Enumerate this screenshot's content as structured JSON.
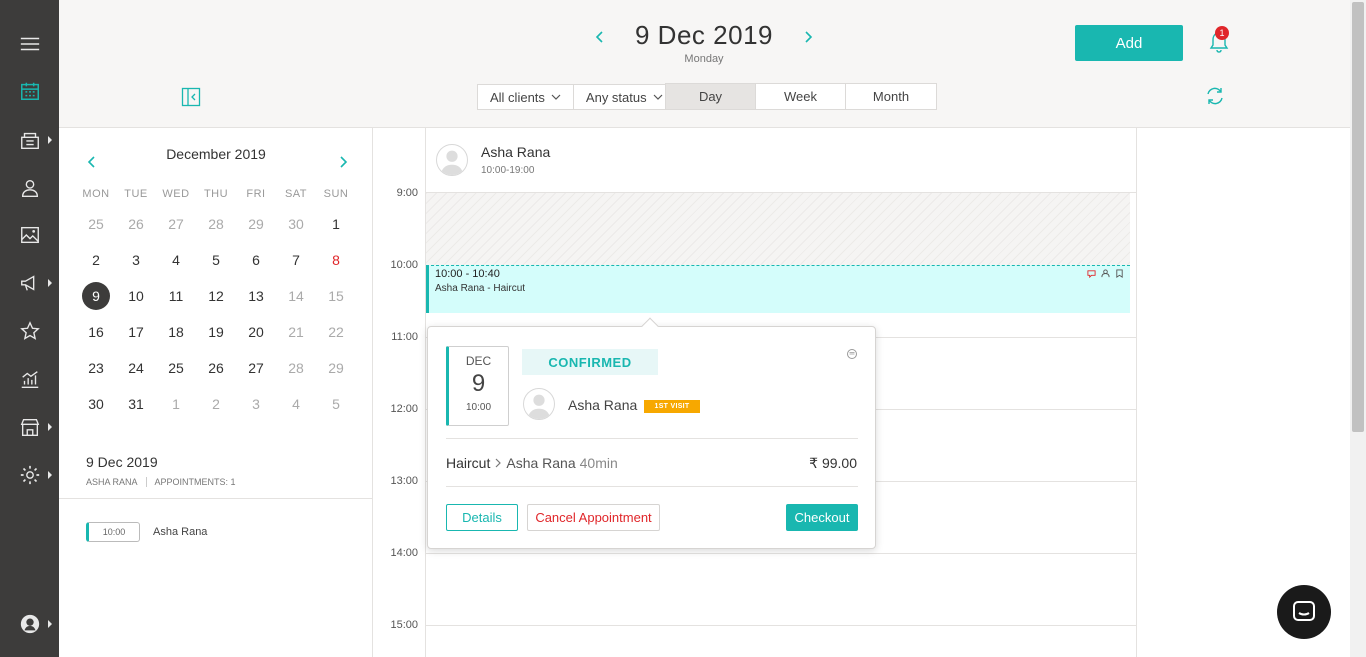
{
  "nav": {
    "items": [
      {
        "icon": "menu-icon"
      },
      {
        "icon": "calendar-icon",
        "active": true
      },
      {
        "icon": "inventory-icon",
        "has_submenu": true
      },
      {
        "icon": "clients-icon"
      },
      {
        "icon": "gallery-icon"
      },
      {
        "icon": "marketing-icon",
        "has_submenu": true
      },
      {
        "icon": "star-icon"
      },
      {
        "icon": "reports-icon"
      },
      {
        "icon": "store-icon",
        "has_submenu": true
      },
      {
        "icon": "settings-icon",
        "has_submenu": true
      },
      {
        "icon": "profile-icon",
        "has_submenu": true
      }
    ]
  },
  "header": {
    "date_title": "9 Dec 2019",
    "date_sub": "Monday",
    "add_label": "Add",
    "notification_count": "1",
    "filters": {
      "clients": "All clients",
      "status": "Any status"
    },
    "views": [
      "Day",
      "Week",
      "Month"
    ],
    "active_view": "Day"
  },
  "mini_calendar": {
    "title": "December 2019",
    "weekdays": [
      "MON",
      "TUE",
      "WED",
      "THU",
      "FRI",
      "SAT",
      "SUN"
    ],
    "weeks": [
      [
        "25",
        "26",
        "27",
        "28",
        "29",
        "30",
        "1"
      ],
      [
        "2",
        "3",
        "4",
        "5",
        "6",
        "7",
        "8"
      ],
      [
        "9",
        "10",
        "11",
        "12",
        "13",
        "14",
        "15"
      ],
      [
        "16",
        "17",
        "18",
        "19",
        "20",
        "21",
        "22"
      ],
      [
        "23",
        "24",
        "25",
        "26",
        "27",
        "28",
        "29"
      ],
      [
        "30",
        "31",
        "1",
        "2",
        "3",
        "4",
        "5"
      ]
    ],
    "selected": "9",
    "holiday": "8"
  },
  "side_summary": {
    "date": "9 Dec 2019",
    "staff": "ASHA RANA",
    "appointments": "APPOINTMENTS: 1",
    "appt_time": "10:00",
    "appt_name": "Asha Rana"
  },
  "day_grid": {
    "times": [
      "9:00",
      "10:00",
      "11:00",
      "12:00",
      "13:00",
      "14:00",
      "15:00"
    ],
    "staff_name": "Asha Rana",
    "staff_hours": "10:00-19:00",
    "event_time": "10:00 - 10:40",
    "event_desc": "Asha Rana - Haircut"
  },
  "popover": {
    "month": "DEC",
    "day": "9",
    "time": "10:00",
    "status": "CONFIRMED",
    "client": "Asha Rana",
    "visit_badge": "1ST VISIT",
    "service": "Haircut",
    "staff": "Asha Rana",
    "duration": "40min",
    "price": "₹ 99.00",
    "details_label": "Details",
    "cancel_label": "Cancel Appointment",
    "checkout_label": "Checkout"
  },
  "colors": {
    "accent": "#19b7b0",
    "nav_bg": "#3d3c3b",
    "danger": "#e0262a",
    "badge": "#f7a800",
    "event_bg": "#d4fdfb"
  }
}
